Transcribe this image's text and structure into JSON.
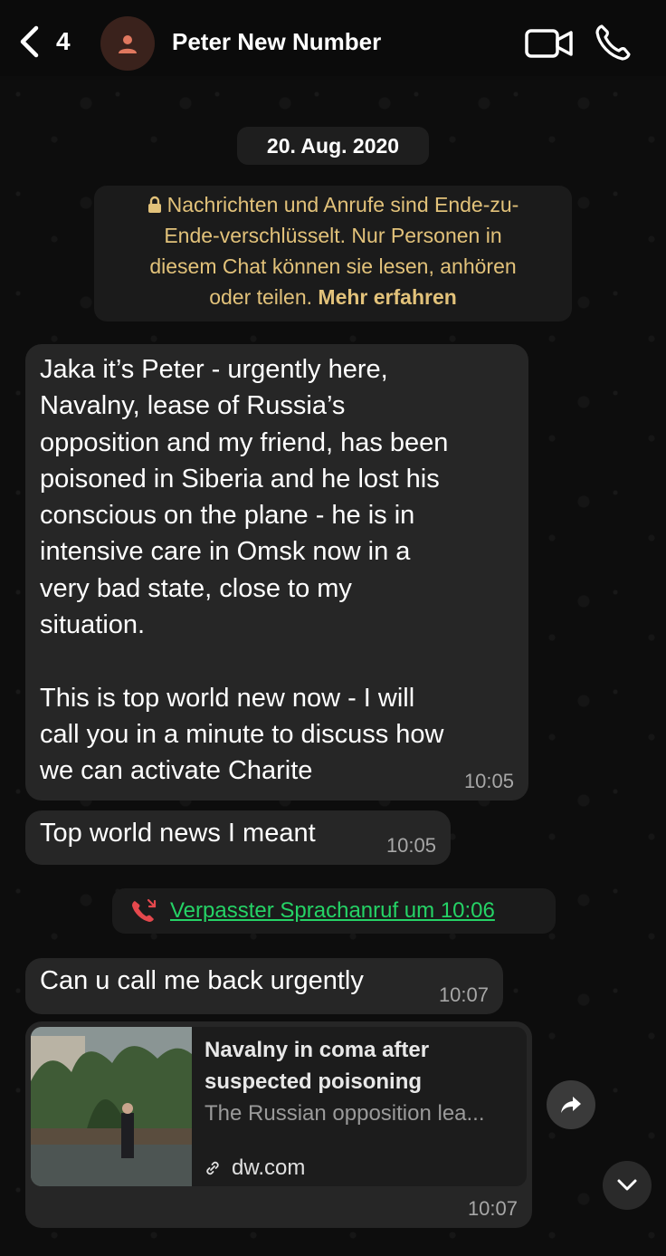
{
  "header": {
    "back_count": "4",
    "contact_name": "Peter New Number",
    "avatar_icon": "person-icon",
    "avatar_color": "#e0785f",
    "video_icon": "video-camera-icon",
    "call_icon": "phone-icon"
  },
  "date_label": "20. Aug. 2020",
  "encryption_notice": {
    "lines": [
      "Nachrichten und Anrufe sind Ende-zu-",
      "Ende-verschlüsselt. Nur Personen in",
      "diesem Chat können sie lesen, anhören"
    ],
    "last_line": "oder teilen.",
    "link": "Mehr erfahren",
    "color": "#e2c27a"
  },
  "messages": [
    {
      "text": "Jaka it’s Peter - urgently here,\nNavalny, lease of Russia’s\nopposition and my friend, has been\npoisoned in Siberia and he lost his\nconscious on the plane - he is in\nintensive care in Omsk now in a\nvery bad state, close to my\nsituation.\n\nThis is top world new now - I will\ncall you in a minute to discuss how\nwe can activate Charite",
      "time": "10:05"
    },
    {
      "text": "Top world news I meant",
      "time": "10:05"
    },
    {
      "text": "Can u call me back urgently",
      "time": "10:07"
    }
  ],
  "missed_call": {
    "icon": "missed-call-icon",
    "text": "Verpasster Sprachanruf um 10:06",
    "color": "#25d366"
  },
  "link_message": {
    "title": "Navalny in coma after suspected poisoning",
    "description": "The Russian opposition lea...",
    "domain": "dw.com",
    "time": "10:07"
  },
  "buttons": {
    "forward_icon": "forward-icon",
    "scroll_down_icon": "chevron-down-icon"
  }
}
